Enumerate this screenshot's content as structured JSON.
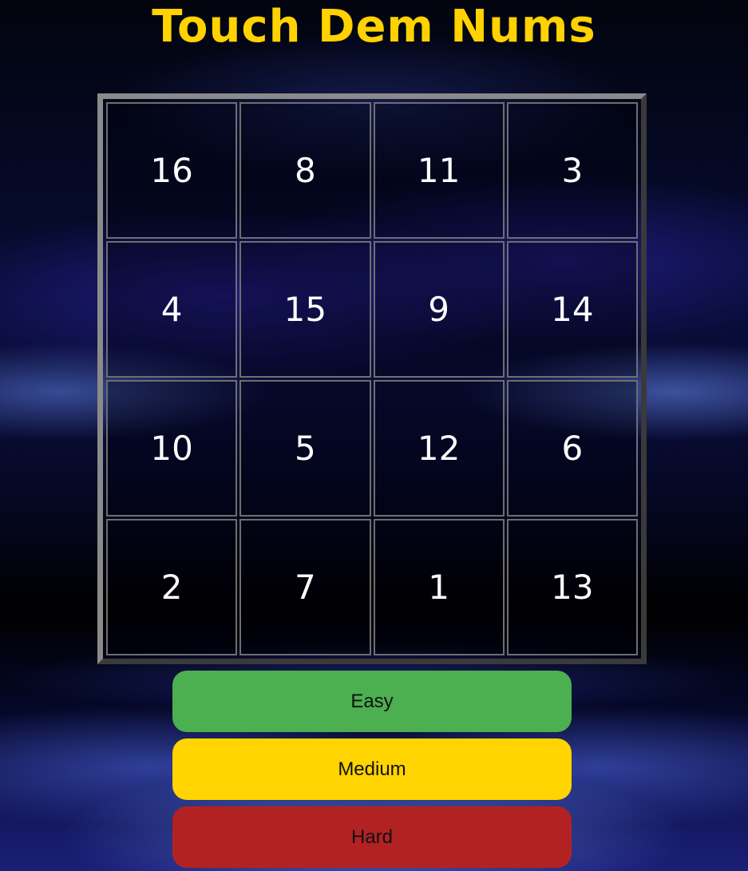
{
  "title": "Touch Dem Nums",
  "board": {
    "tiles": [
      16,
      8,
      11,
      3,
      4,
      15,
      9,
      14,
      10,
      5,
      12,
      6,
      2,
      7,
      1,
      13
    ]
  },
  "buttons": {
    "easy": "Easy",
    "medium": "Medium",
    "hard": "Hard"
  },
  "colors": {
    "title": "#ffd200",
    "easy": "#4caf50",
    "medium": "#ffd400",
    "hard": "#b22222",
    "tile_text": "#ffffff"
  }
}
